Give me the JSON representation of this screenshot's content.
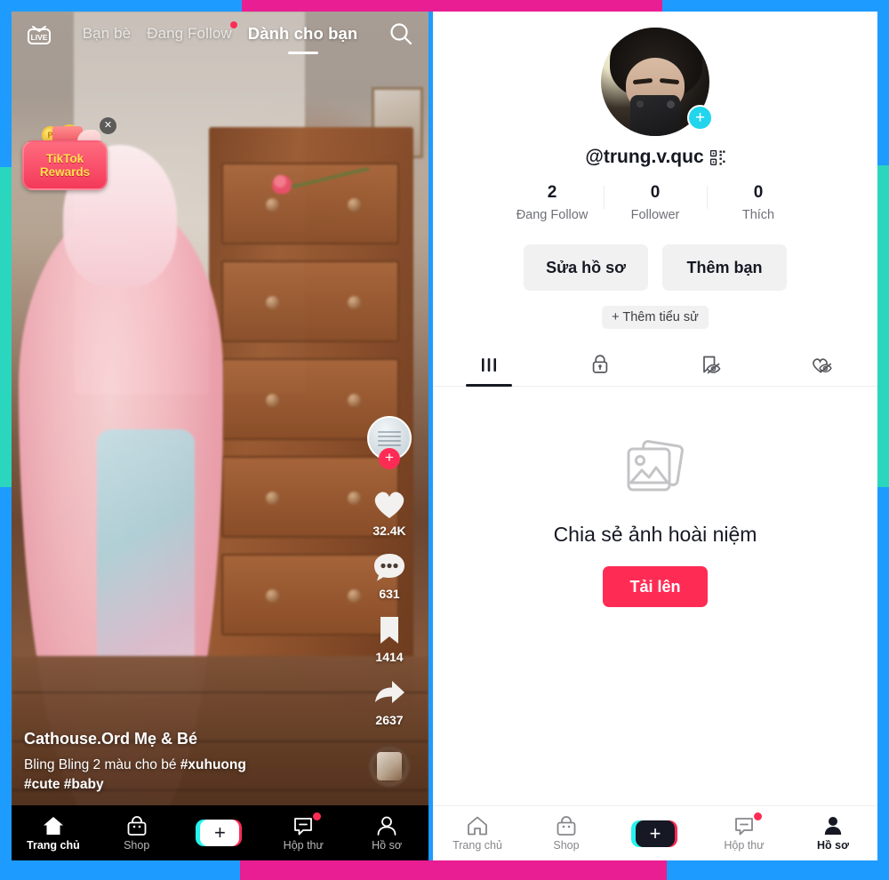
{
  "frame": {
    "blue": "#1e9bff",
    "magenta": "#e91e93",
    "teal": "#2ad6bd"
  },
  "feed": {
    "live_label": "LIVE",
    "tabs": [
      {
        "label": "Bạn bè",
        "active": false,
        "dot": false
      },
      {
        "label": "Đang Follow",
        "active": false,
        "dot": true
      },
      {
        "label": "Dành cho bạn",
        "active": true,
        "dot": false
      }
    ],
    "search_icon": "search-icon",
    "rewards": {
      "line1": "TikTok",
      "line2": "Rewards",
      "coin_symbol": "P",
      "close_icon": "✕"
    },
    "actions": [
      {
        "icon": "heart-icon",
        "count": "32.4K"
      },
      {
        "icon": "comment-icon",
        "count": "631"
      },
      {
        "icon": "bookmark-icon",
        "count": "1414"
      },
      {
        "icon": "share-icon",
        "count": "2637"
      }
    ],
    "follow_plus": "+",
    "caption": {
      "author": "Cathouse.Ord Mẹ & Bé",
      "text_plain": "Bling Bling 2 màu cho bé ",
      "hashtag1": "#xuhuong",
      "hashtags2": "#cute #baby"
    },
    "bottom_nav": [
      {
        "label": "Trang chủ",
        "icon": "home-icon",
        "active": true
      },
      {
        "label": "Shop",
        "icon": "shop-bag-icon",
        "active": false
      },
      {
        "label": "",
        "icon": "create-plus-icon",
        "active": false
      },
      {
        "label": "Hộp thư",
        "icon": "inbox-icon",
        "active": false,
        "badge": true
      },
      {
        "label": "Hồ sơ",
        "icon": "person-icon",
        "active": false
      }
    ],
    "create_label": "+"
  },
  "profile": {
    "handle": "@trung.v.quc",
    "qr_icon": "qr-code-icon",
    "avatar_add": "+",
    "stats": [
      {
        "value": "2",
        "label": "Đang Follow"
      },
      {
        "value": "0",
        "label": "Follower"
      },
      {
        "value": "0",
        "label": "Thích"
      }
    ],
    "edit_profile_label": "Sửa hồ sơ",
    "add_friends_label": "Thêm bạn",
    "add_bio_label": "+ Thêm tiểu sử",
    "tabs": [
      {
        "icon": "grid-posts-icon",
        "active": true
      },
      {
        "icon": "lock-private-icon",
        "active": false
      },
      {
        "icon": "bookmark-hidden-icon",
        "active": false
      },
      {
        "icon": "heart-hidden-icon",
        "active": false
      }
    ],
    "empty": {
      "icon": "photos-stack-icon",
      "title": "Chia sẻ ảnh hoài niệm",
      "upload_label": "Tải lên",
      "upload_color": "#fe2c55"
    },
    "bottom_nav": [
      {
        "label": "Trang chủ",
        "icon": "home-icon",
        "active": false
      },
      {
        "label": "Shop",
        "icon": "shop-bag-icon",
        "active": false
      },
      {
        "label": "",
        "icon": "create-plus-icon",
        "active": false
      },
      {
        "label": "Hộp thư",
        "icon": "inbox-icon",
        "active": false,
        "badge": true
      },
      {
        "label": "Hồ sơ",
        "icon": "person-icon",
        "active": true
      }
    ],
    "create_label": "+"
  }
}
